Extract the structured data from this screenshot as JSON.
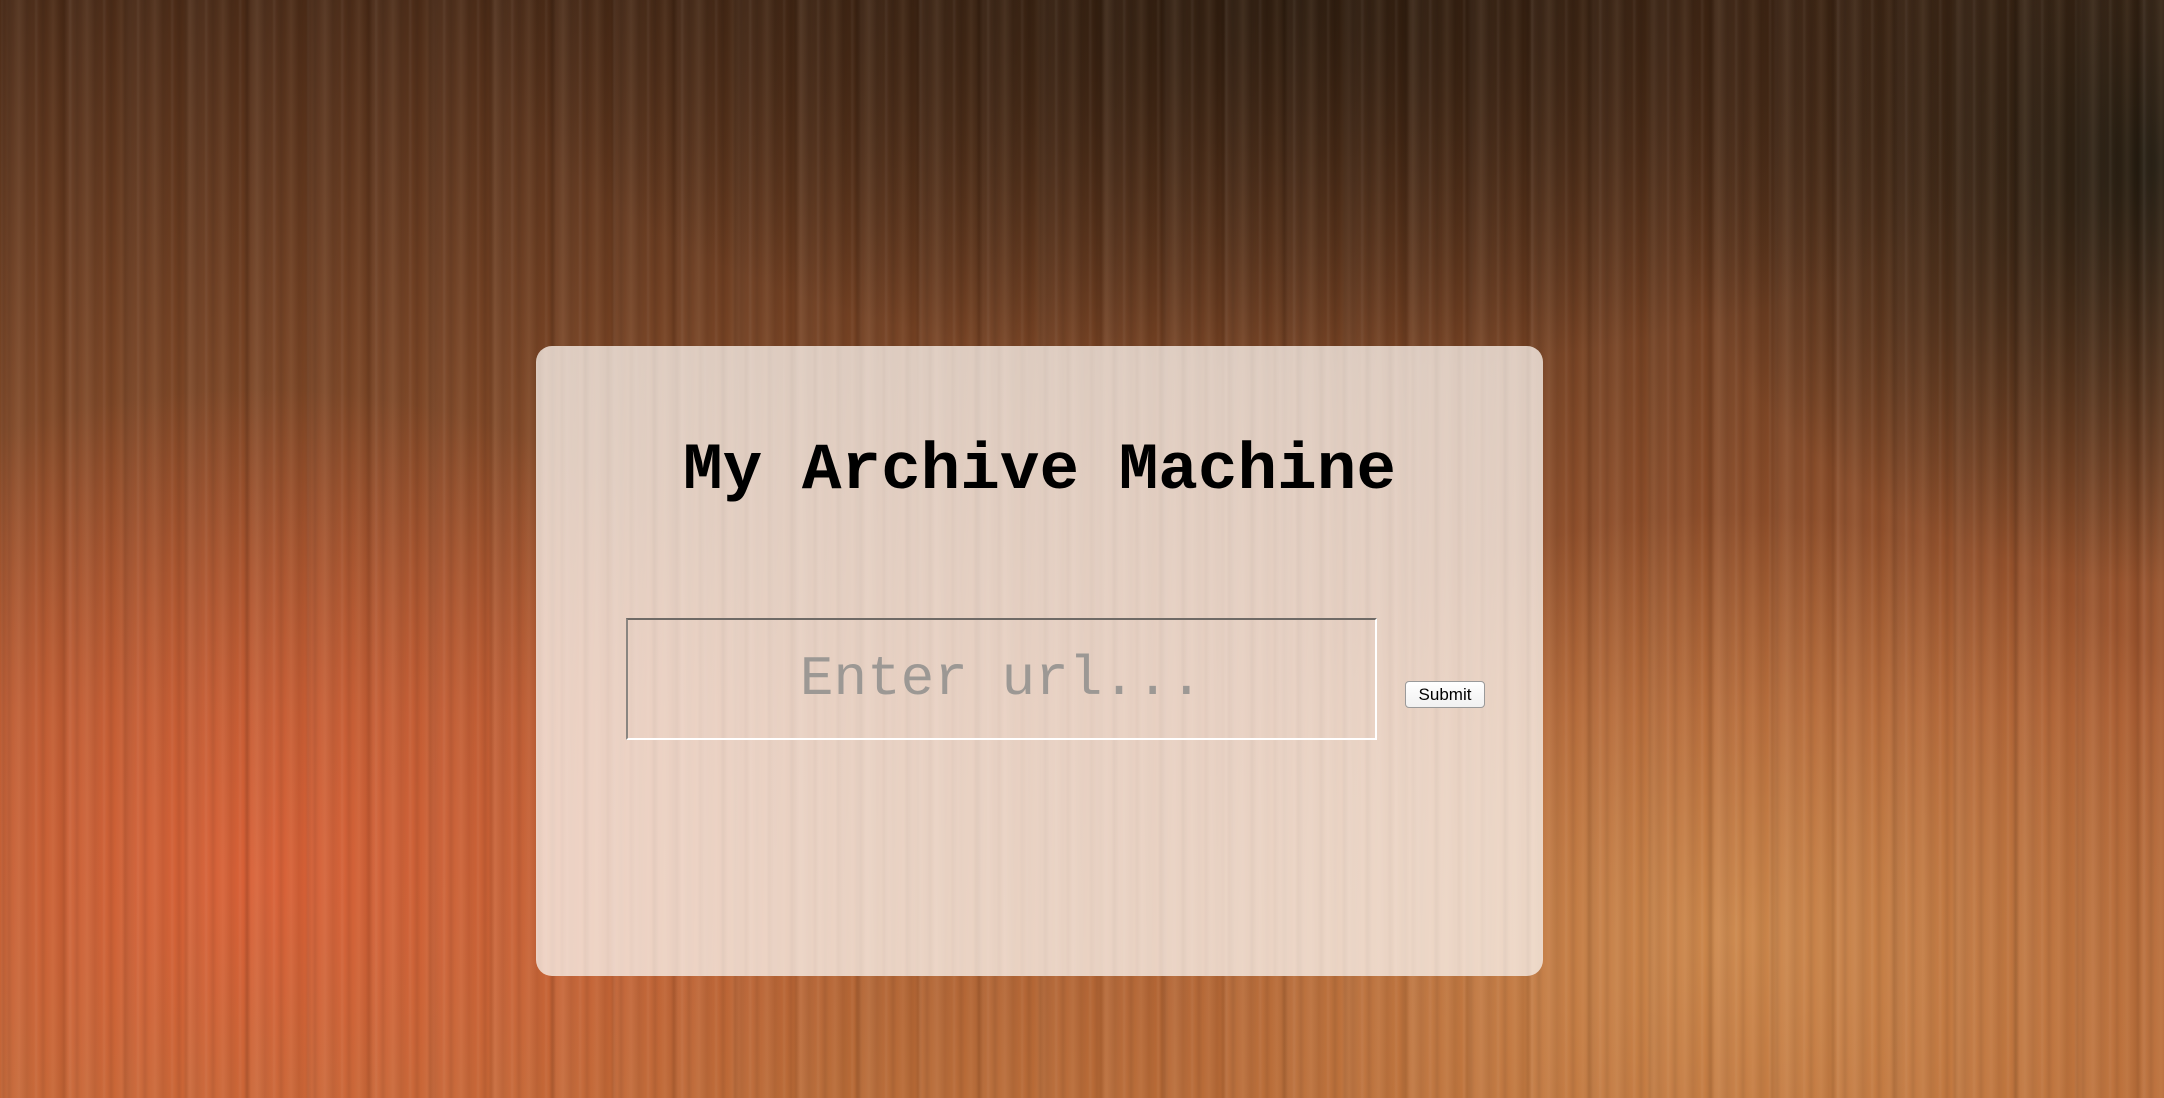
{
  "page": {
    "title": "My Archive Machine"
  },
  "form": {
    "url_placeholder": "Enter url...",
    "url_value": "",
    "submit_label": "Submit"
  },
  "colors": {
    "background_dark": "#4a2a16",
    "background_warm": "#d45a33",
    "card": "#f8eee6",
    "title_text": "#000000",
    "placeholder_text": "#9c9894"
  }
}
